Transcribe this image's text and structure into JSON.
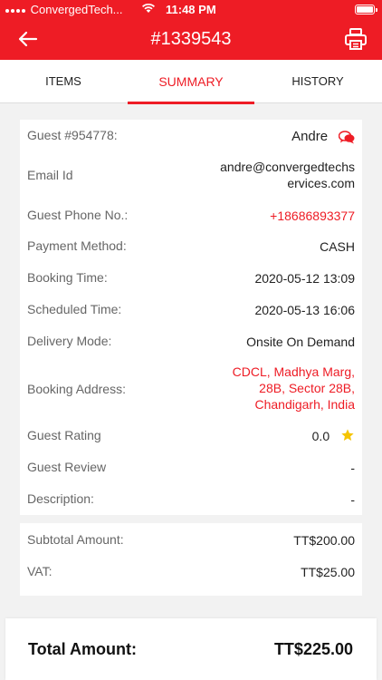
{
  "status_bar": {
    "carrier": "ConvergedTech...",
    "time": "11:48 PM"
  },
  "header": {
    "title": "#1339543"
  },
  "tabs": [
    {
      "label": "ITEMS"
    },
    {
      "label": "SUMMARY"
    },
    {
      "label": "HISTORY"
    }
  ],
  "details": {
    "guest": {
      "label": "Guest #954778:",
      "value": "Andre"
    },
    "email": {
      "label": "Email Id",
      "value_line1": "andre@convergedtechs",
      "value_line2": "ervices.com"
    },
    "phone": {
      "label": "Guest Phone No.:",
      "value": "+18686893377"
    },
    "payment": {
      "label": "Payment Method:",
      "value": "CASH"
    },
    "booking_time": {
      "label": "Booking Time:",
      "value": "2020-05-12 13:09"
    },
    "scheduled_time": {
      "label": "Scheduled Time:",
      "value": "2020-05-13 16:06"
    },
    "delivery_mode": {
      "label": "Delivery Mode:",
      "value": "Onsite On Demand"
    },
    "address": {
      "label": "Booking Address:",
      "line1": "CDCL, Madhya Marg,",
      "line2": "28B, Sector 28B,",
      "line3": "Chandigarh, India"
    },
    "rating": {
      "label": "Guest Rating",
      "value": "0.0"
    },
    "review": {
      "label": "Guest Review",
      "value": "-"
    },
    "description": {
      "label": "Description:",
      "value": "-"
    }
  },
  "amounts": {
    "subtotal": {
      "label": "Subtotal Amount:",
      "value": "TT$200.00"
    },
    "vat": {
      "label": "VAT:",
      "value": "TT$25.00"
    }
  },
  "total": {
    "label": "Total Amount:",
    "value": "TT$225.00"
  },
  "colors": {
    "accent": "#ee1c25",
    "background": "#f2f2f2",
    "star": "#f5c400"
  }
}
